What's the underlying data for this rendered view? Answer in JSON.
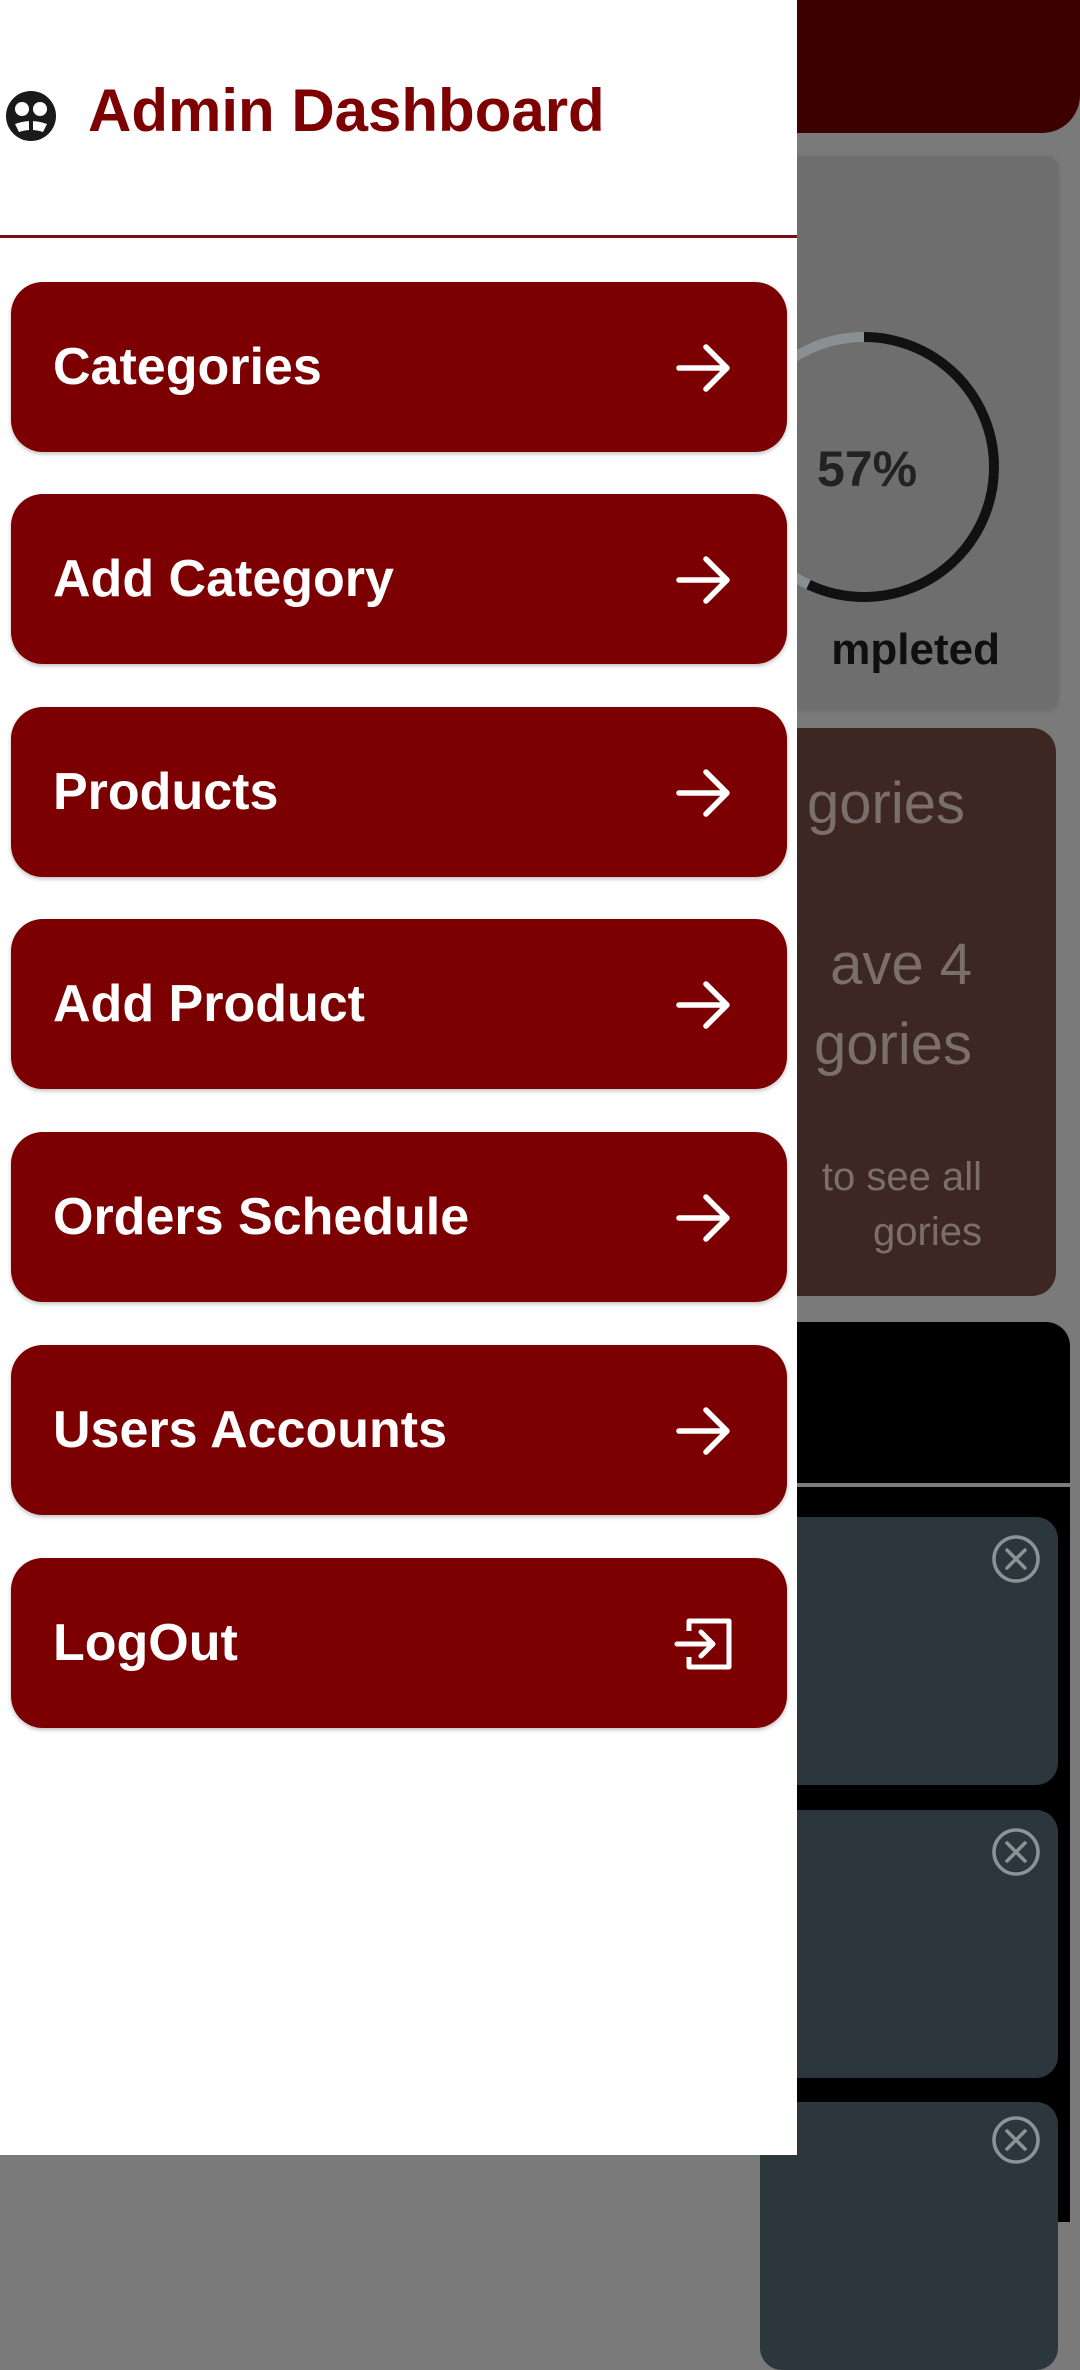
{
  "drawer": {
    "title": "Admin Dashboard",
    "logo_icon": "admin-face-icon",
    "accent_color": "#7c0001",
    "items": [
      {
        "label": "Categories",
        "icon": "arrow-right-icon"
      },
      {
        "label": "Add Category",
        "icon": "arrow-right-icon"
      },
      {
        "label": "Products",
        "icon": "arrow-right-icon"
      },
      {
        "label": "Add Product",
        "icon": "arrow-right-icon"
      },
      {
        "label": "Orders Schedule",
        "icon": "arrow-right-icon"
      },
      {
        "label": "Users Accounts",
        "icon": "arrow-right-icon"
      },
      {
        "label": "LogOut",
        "icon": "logout-icon"
      }
    ]
  },
  "background": {
    "progress": {
      "percent_text": "57%",
      "fraction": 0.57,
      "label": "mpleted"
    },
    "categories_card": {
      "title": "gories",
      "count_text": "ave 4\ngories",
      "hint": "to see all\ngories"
    }
  }
}
